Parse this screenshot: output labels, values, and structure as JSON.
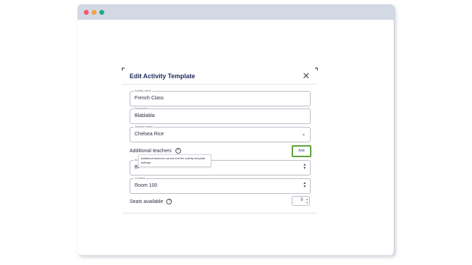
{
  "modal": {
    "title": "Edit Activity Template",
    "close_icon": "close-icon"
  },
  "fields": {
    "activity_name": {
      "label": "Activity name",
      "value": "French Class"
    },
    "description": {
      "label": "Description",
      "value": "Blablabla"
    },
    "teacher": {
      "label": "Teacher (main)",
      "value": "Chelsea Rice"
    },
    "activity_type": {
      "label": "Ac",
      "value": "Bl"
    },
    "location": {
      "label": "Location",
      "value": "Room 100"
    }
  },
  "additional_teachers": {
    "label": "Additional teachers",
    "add_label": "Add",
    "tooltip": "Additional teachers cannot edit the activity template settings"
  },
  "seats": {
    "label": "Seats available",
    "value": "0"
  }
}
